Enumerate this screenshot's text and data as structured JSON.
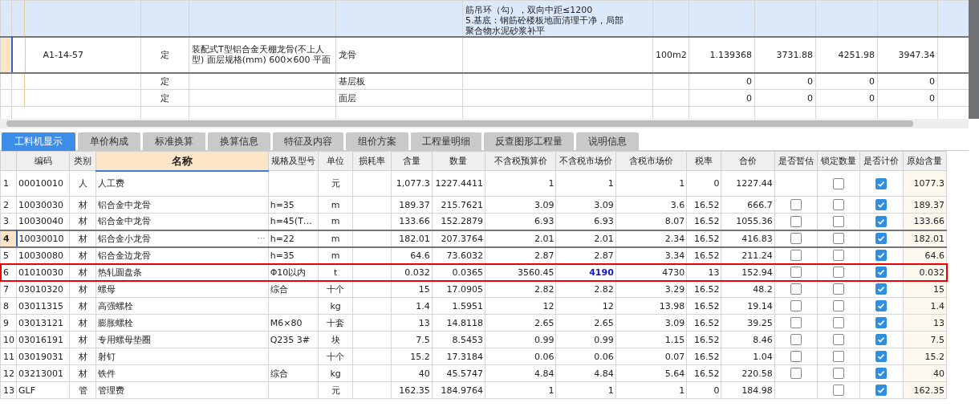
{
  "top_table": {
    "rows": [
      {
        "features": [
          "筋吊环（勾），双向中距≤1200",
          "5.基底：钢筋砼楼板地面清理干净，局部",
          "聚合物水泥砂浆补平"
        ],
        "highlighted": true,
        "selected": false
      },
      {
        "code": "A1-14-57",
        "type": "定",
        "name": "装配式T型铝合金天棚龙骨(不上人型) 面层规格(mm) 600×600 平面",
        "column_4": "龙骨",
        "unit": "100m2",
        "quantity": "1.139368",
        "column_8": "3731.88",
        "column_9": "4251.98",
        "column_10": "3947.34",
        "highlighted": false,
        "selected": true
      },
      {
        "type": "定",
        "column_4": "基层板",
        "quantity": "0",
        "column_8": "0",
        "column_9": "0",
        "column_10": "0",
        "highlighted": false,
        "selected": false
      },
      {
        "type": "定",
        "column_4": "面层",
        "quantity": "0",
        "column_8": "0",
        "column_9": "0",
        "column_10": "0",
        "highlighted": false,
        "selected": false
      }
    ]
  },
  "tabs": [
    {
      "label": "工料机显示",
      "selected": true
    },
    {
      "label": "单价构成",
      "selected": false
    },
    {
      "label": "标准换算",
      "selected": false
    },
    {
      "label": "换算信息",
      "selected": false
    },
    {
      "label": "特征及内容",
      "selected": false
    },
    {
      "label": "组价方案",
      "selected": false
    },
    {
      "label": "工程量明细",
      "selected": false
    },
    {
      "label": "反查图形工程量",
      "selected": false
    },
    {
      "label": "说明信息",
      "selected": false
    }
  ],
  "resource_table": {
    "columns": [
      "编码",
      "类别",
      "名称",
      "规格及型号",
      "单位",
      "损耗率",
      "含量",
      "数量",
      "不含税预算价",
      "不含税市场价",
      "含税市场价",
      "税率",
      "合价",
      "是否暂估",
      "锁定数量",
      "是否计价",
      "原始含量"
    ],
    "rows": [
      {
        "no": "1",
        "code": "00010010",
        "type": "人",
        "name": "人工费",
        "unit": "元",
        "content": "1,077.3",
        "quantity": "1227.4411",
        "budget_price": "1",
        "market_price": "1",
        "market_price_tax": "1",
        "tax_rate": "0",
        "total": "1227.44",
        "locked": false,
        "priced": true,
        "original_content": "1077.3",
        "selected": false,
        "outlined": false,
        "price_highlighted": false
      },
      {
        "no": "2",
        "code": "10030030",
        "type": "材",
        "name": "铝合金中龙骨",
        "spec": "h=35",
        "unit": "m",
        "content": "189.37",
        "quantity": "215.7621",
        "budget_price": "3.09",
        "market_price": "3.09",
        "market_price_tax": "3.6",
        "tax_rate": "16.52",
        "total": "666.7",
        "provisional": false,
        "locked": false,
        "priced": true,
        "original_content": "189.37",
        "selected": false,
        "outlined": false,
        "price_highlighted": false
      },
      {
        "no": "3",
        "code": "10030040",
        "type": "材",
        "name": "铝合金中龙骨",
        "spec": "h=45(T…",
        "unit": "m",
        "content": "133.66",
        "quantity": "152.2879",
        "budget_price": "6.93",
        "market_price": "6.93",
        "market_price_tax": "8.07",
        "tax_rate": "16.52",
        "total": "1055.36",
        "provisional": false,
        "locked": false,
        "priced": true,
        "original_content": "133.66",
        "selected": false,
        "outlined": false,
        "price_highlighted": false
      },
      {
        "no": "4",
        "code": "10030010",
        "type": "材",
        "name": "铝合金小龙骨",
        "more": "···",
        "spec": "h=22",
        "unit": "m",
        "content": "182.01",
        "quantity": "207.3764",
        "budget_price": "2.01",
        "market_price": "2.01",
        "market_price_tax": "2.34",
        "tax_rate": "16.52",
        "total": "416.83",
        "provisional": false,
        "locked": false,
        "priced": true,
        "original_content": "182.01",
        "selected": true,
        "outlined": false,
        "price_highlighted": false
      },
      {
        "no": "5",
        "code": "10030080",
        "type": "材",
        "name": "铝合金边龙骨",
        "spec": "h=35",
        "unit": "m",
        "content": "64.6",
        "quantity": "73.6032",
        "budget_price": "2.87",
        "market_price": "2.87",
        "market_price_tax": "3.34",
        "tax_rate": "16.52",
        "total": "211.24",
        "provisional": false,
        "locked": false,
        "priced": true,
        "original_content": "64.6",
        "selected": false,
        "outlined": false,
        "price_highlighted": false
      },
      {
        "no": "6",
        "code": "01010030",
        "type": "材",
        "name": "热轧圆盘条",
        "spec": "Φ10以内",
        "unit": "t",
        "content": "0.032",
        "quantity": "0.0365",
        "budget_price": "3560.45",
        "market_price": "4190",
        "market_price_tax": "4730",
        "tax_rate": "13",
        "total": "152.94",
        "provisional": false,
        "locked": false,
        "priced": true,
        "original_content": "0.032",
        "selected": false,
        "outlined": true,
        "price_highlighted": true
      },
      {
        "no": "7",
        "code": "03010320",
        "type": "材",
        "name": "螺母",
        "spec": "综合",
        "unit": "十个",
        "content": "15",
        "quantity": "17.0905",
        "budget_price": "2.82",
        "market_price": "2.82",
        "market_price_tax": "3.29",
        "tax_rate": "16.52",
        "total": "48.2",
        "provisional": false,
        "locked": false,
        "priced": true,
        "original_content": "15",
        "selected": false,
        "outlined": false,
        "price_highlighted": false
      },
      {
        "no": "8",
        "code": "03011315",
        "type": "材",
        "name": "高强螺栓",
        "unit": "kg",
        "content": "1.4",
        "quantity": "1.5951",
        "budget_price": "12",
        "market_price": "12",
        "market_price_tax": "13.98",
        "tax_rate": "16.52",
        "total": "19.14",
        "provisional": false,
        "locked": false,
        "priced": true,
        "original_content": "1.4",
        "selected": false,
        "outlined": false,
        "price_highlighted": false
      },
      {
        "no": "9",
        "code": "03013121",
        "type": "材",
        "name": "膨胀螺栓",
        "spec": "M6×80",
        "unit": "十套",
        "content": "13",
        "quantity": "14.8118",
        "budget_price": "2.65",
        "market_price": "2.65",
        "market_price_tax": "3.09",
        "tax_rate": "16.52",
        "total": "39.25",
        "provisional": false,
        "locked": false,
        "priced": true,
        "original_content": "13",
        "selected": false,
        "outlined": false,
        "price_highlighted": false
      },
      {
        "no": "10",
        "code": "03016191",
        "type": "材",
        "name": "专用螺母垫圈",
        "spec": "Q235 3#",
        "unit": "块",
        "content": "7.5",
        "quantity": "8.5453",
        "budget_price": "0.99",
        "market_price": "0.99",
        "market_price_tax": "1.15",
        "tax_rate": "16.52",
        "total": "8.46",
        "provisional": false,
        "locked": false,
        "priced": true,
        "original_content": "7.5",
        "selected": false,
        "outlined": false,
        "price_highlighted": false
      },
      {
        "no": "11",
        "code": "03019031",
        "type": "材",
        "name": "射钉",
        "unit": "十个",
        "content": "15.2",
        "quantity": "17.3184",
        "budget_price": "0.06",
        "market_price": "0.06",
        "market_price_tax": "0.07",
        "tax_rate": "16.52",
        "total": "1.04",
        "provisional": false,
        "locked": false,
        "priced": true,
        "original_content": "15.2",
        "selected": false,
        "outlined": false,
        "price_highlighted": false
      },
      {
        "no": "12",
        "code": "03213001",
        "type": "材",
        "name": "铁件",
        "spec": "综合",
        "unit": "kg",
        "content": "40",
        "quantity": "45.5747",
        "budget_price": "4.84",
        "market_price": "4.84",
        "market_price_tax": "5.64",
        "tax_rate": "16.52",
        "total": "220.58",
        "provisional": false,
        "locked": false,
        "priced": true,
        "original_content": "40",
        "selected": false,
        "outlined": false,
        "price_highlighted": false
      },
      {
        "no": "13",
        "code": "GLF",
        "type": "管",
        "name": "管理费",
        "unit": "元",
        "content": "162.35",
        "quantity": "184.9764",
        "budget_price": "1",
        "market_price": "1",
        "market_price_tax": "1",
        "tax_rate": "0",
        "total": "184.98",
        "locked": false,
        "priced": true,
        "original_content": "162.35",
        "selected": false,
        "outlined": false,
        "price_highlighted": false
      }
    ]
  }
}
